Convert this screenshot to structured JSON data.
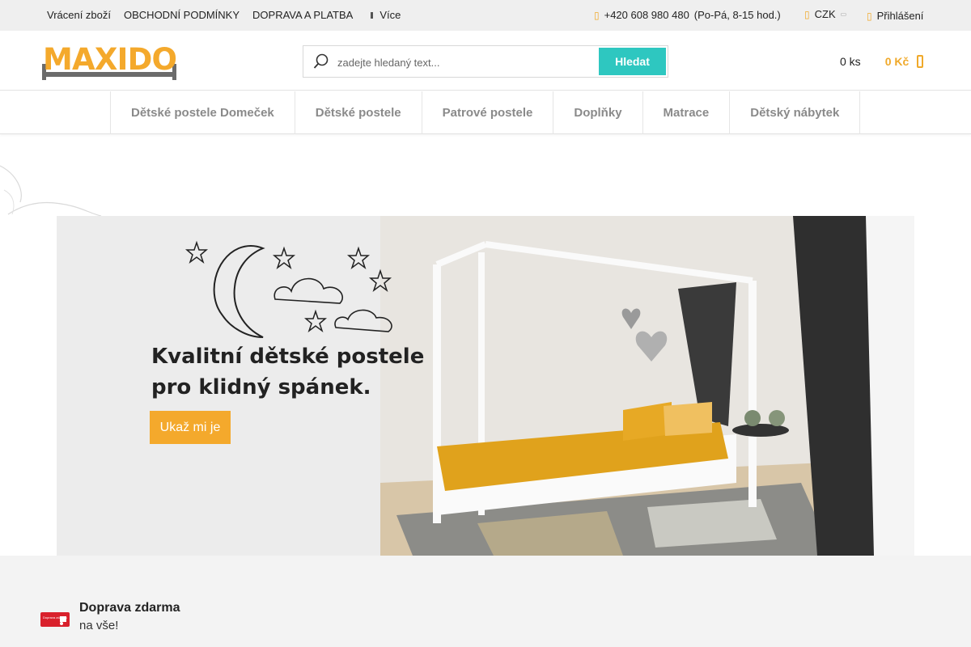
{
  "topbar": {
    "links": [
      "Vrácení zboží",
      "OBCHODNÍ PODMÍNKY",
      "DOPRAVA A PLATBA"
    ],
    "more_label": "Více",
    "phone": "+420 608 980 480",
    "hours": "(Po-Pá, 8-15 hod.)",
    "currency": "CZK",
    "login_label": "Přihlášení"
  },
  "header": {
    "logo_text": "MAXIDO",
    "search_placeholder": "zadejte hledaný text...",
    "search_button": "Hledat",
    "cart_count": "0 ks",
    "cart_total": "0 Kč"
  },
  "nav": {
    "items": [
      "Dětské postele Domeček",
      "Dětské postele",
      "Patrové postele",
      "Doplňky",
      "Matrace",
      "Dětský nábytek"
    ]
  },
  "hero": {
    "headline_line1": "Kvalitní dětské postele",
    "headline_line2": "pro klidný spánek.",
    "cta_label": "Ukaž mi je"
  },
  "benefits": {
    "item1_title": "Doprava zdarma",
    "item1_sub": "na vše!",
    "badge_text": "Doprava zdarma"
  },
  "colors": {
    "accent": "#f4a92c",
    "search_button": "#2ec7c0",
    "nav_text": "#8a8a8a"
  }
}
